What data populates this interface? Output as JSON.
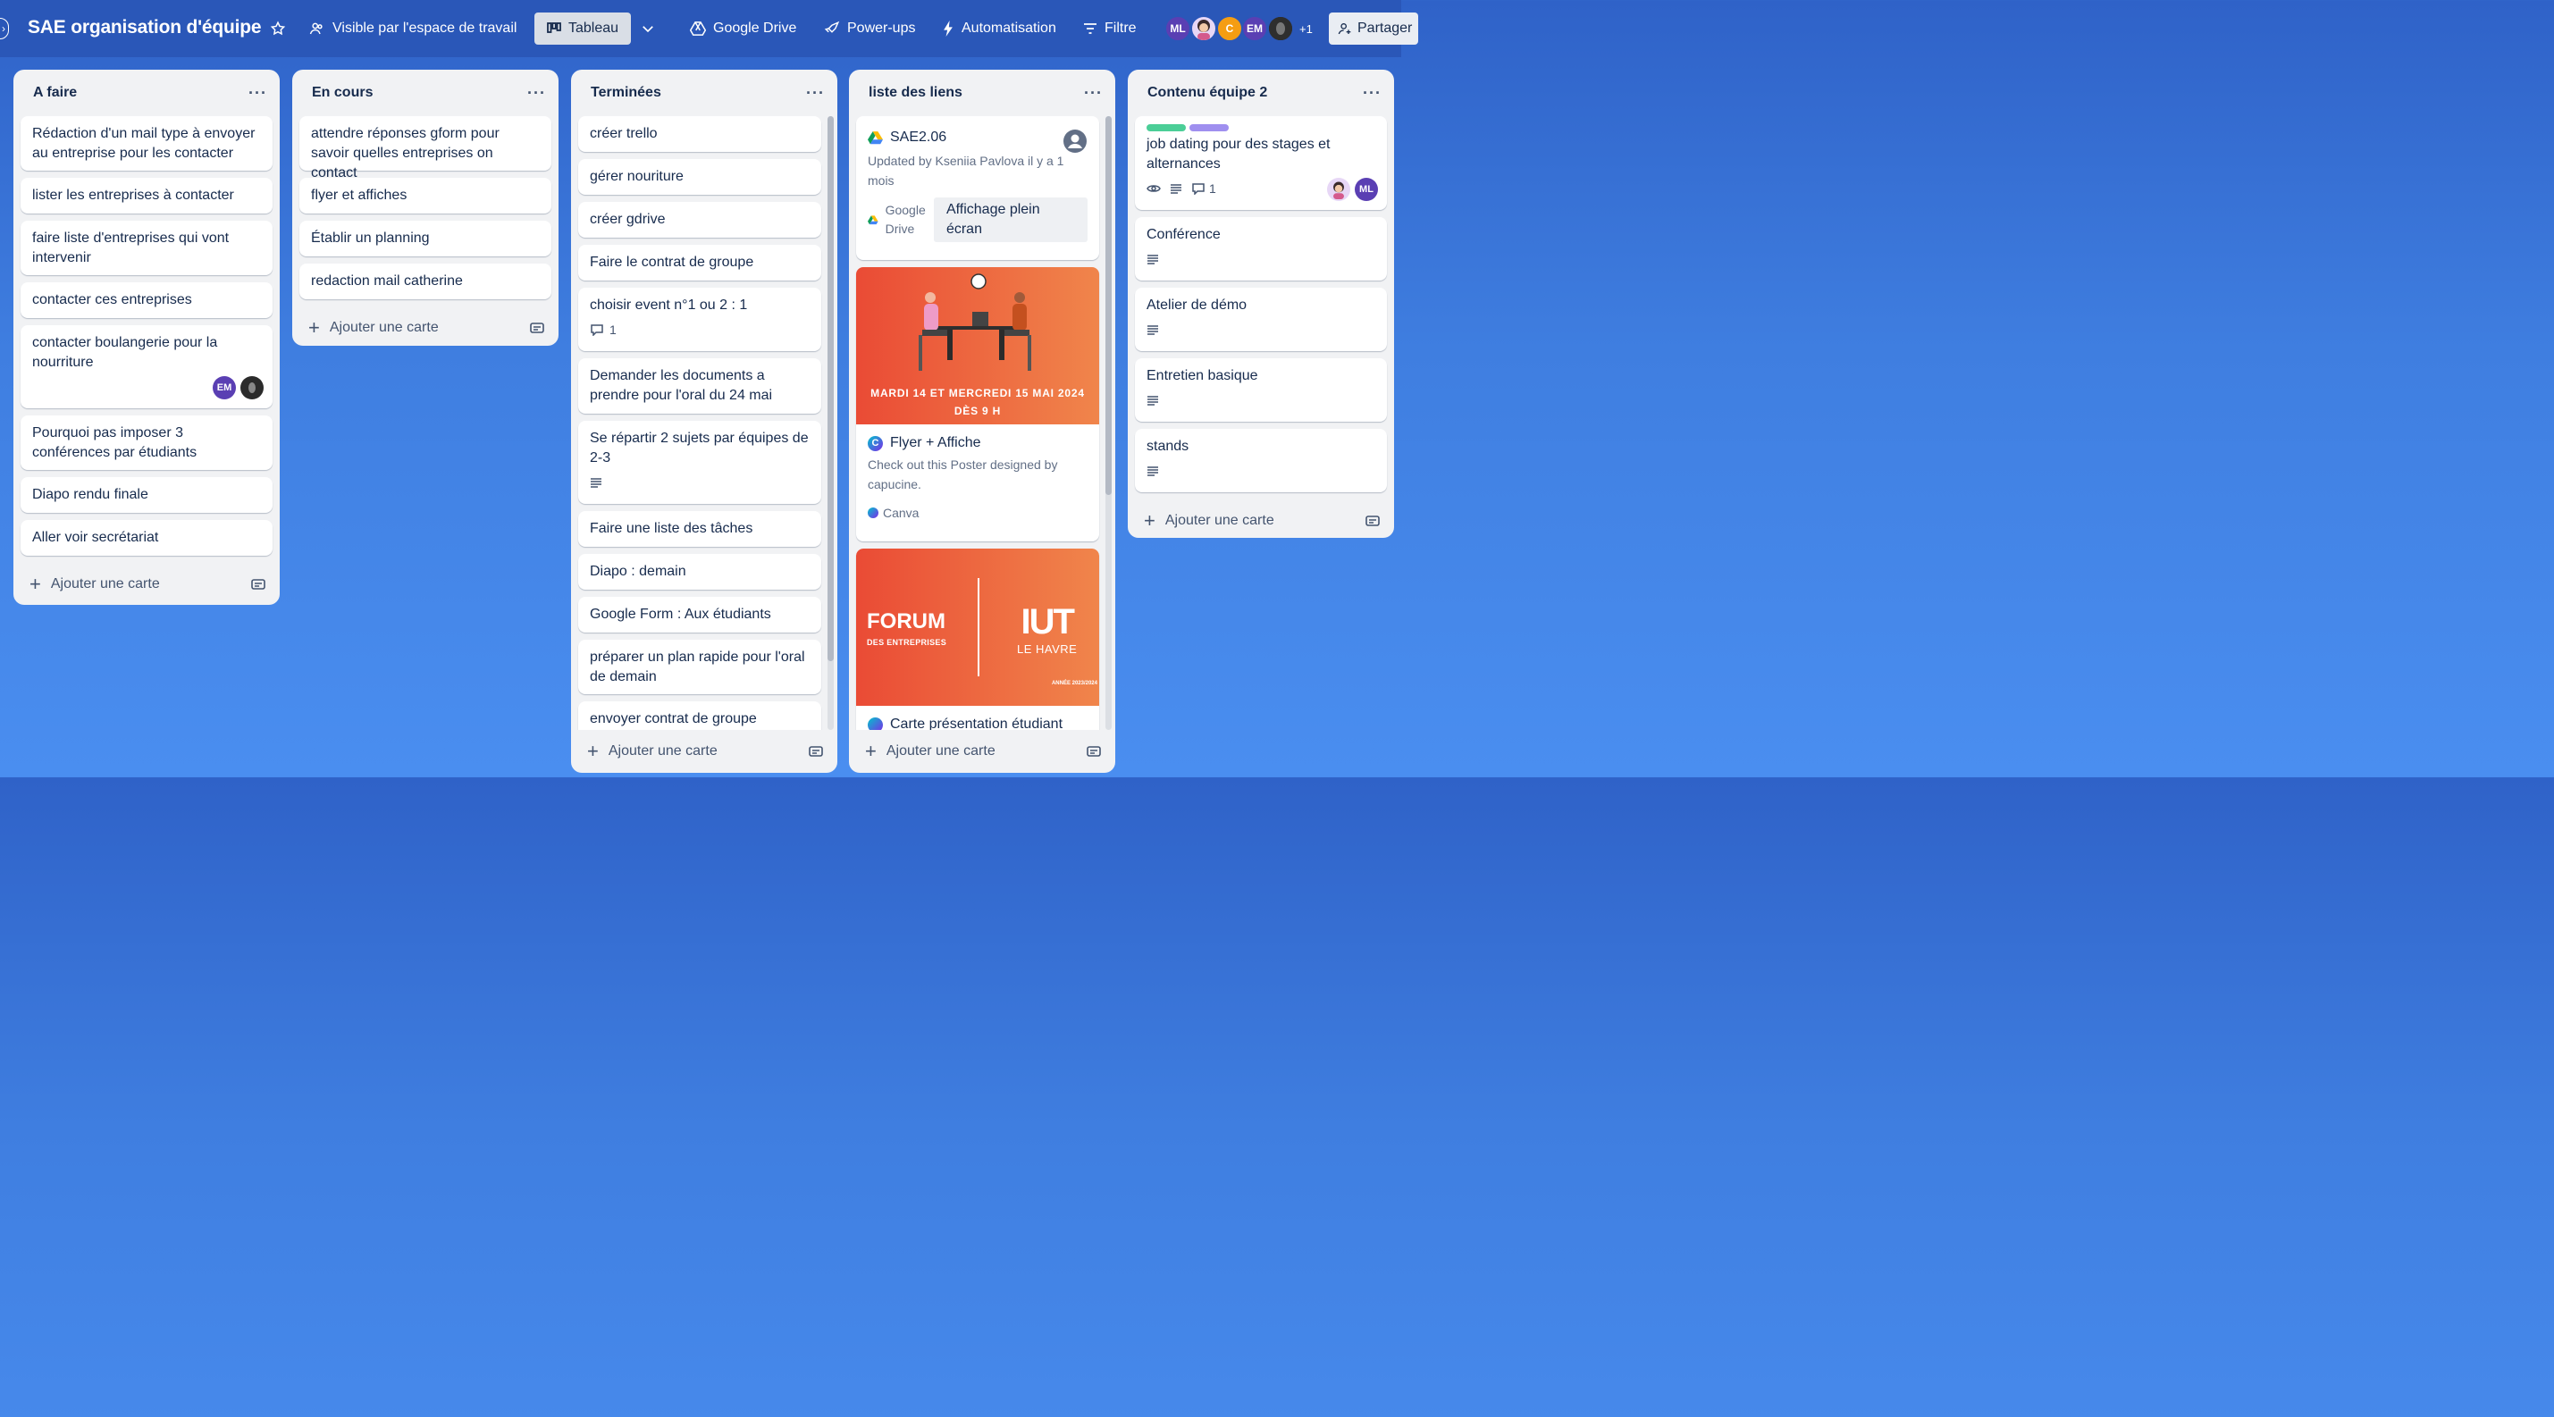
{
  "header": {
    "title": "SAE organisation d'équipe",
    "visibility": "Visible par l'espace de travail",
    "view_tab": "Tableau",
    "google_drive": "Google Drive",
    "powerups": "Power-ups",
    "automation": "Automatisation",
    "filter": "Filtre",
    "members": [
      "ML",
      "C",
      "EM"
    ],
    "more_members": "+1",
    "share": "Partager",
    "colors": {
      "header_bg": "#2a57b8",
      "ml": "#5a3fb3",
      "c": "#f59d12",
      "em": "#5a3fb3"
    }
  },
  "add_card_label": "Ajouter une carte",
  "lists": {
    "todo": {
      "title": "A faire",
      "cards": [
        "Rédaction d'un mail type à envoyer au entreprise pour les contacter",
        "lister les entreprises à contacter",
        "faire liste d'entreprises qui vont intervenir",
        "contacter ces entreprises",
        "contacter boulangerie pour la nourriture",
        "Pourquoi pas imposer 3 conférences par étudiants",
        "Diapo rendu finale",
        "Aller voir secrétariat"
      ],
      "card4_members": [
        "EM"
      ]
    },
    "doing": {
      "title": "En cours",
      "cards": [
        "attendre réponses gform pour savoir quelles entreprises on contact",
        "flyer et affiches",
        "Établir un planning",
        "redaction mail catherine"
      ]
    },
    "done": {
      "title": "Terminées",
      "cards": [
        "créer trello",
        "gérer nouriture",
        "créer gdrive",
        "Faire le contrat de groupe",
        "choisir event n°1 ou 2 : 1",
        "Demander les documents a prendre pour l'oral du 24 mai",
        "Se répartir 2 sujets par équipes de 2-3",
        "Faire une liste des tâches",
        "Diapo : demain",
        "Google Form : Aux étudiants",
        "préparer un plan rapide pour l'oral de demain",
        "envoyer contrat de groupe"
      ],
      "comment_count": "1"
    },
    "links": {
      "title": "liste des liens",
      "drive_card": {
        "title": "SAE2.06",
        "meta": "Updated by Kseniia Pavlova il y a 1 mois",
        "source": "Google Drive",
        "action": "Affichage plein écran"
      },
      "canva_card": {
        "cover_text_1": "MARDI 14 ET MERCREDI 15 MAI 2024",
        "cover_text_2": "DÈS 9 H",
        "title": "Flyer + Affiche",
        "meta": "Check out this Poster designed by capucine.",
        "source": "Canva"
      },
      "forum_card": {
        "forum": "FORUM",
        "forum_sub": "DES ENTREPRISES",
        "iut": "IUT",
        "iut_sub": "LE HAVRE",
        "year": "ANNÉE 2023/2024",
        "title": "Carte présentation étudiant"
      }
    },
    "team2": {
      "title": "Contenu équipe 2",
      "cards": [
        "job dating pour des stages et alternances",
        "Conférence",
        "Atelier de démo",
        "Entretien basique",
        "stands"
      ],
      "comment_count": "1",
      "members": [
        "ML"
      ],
      "label_colors": [
        "#4bce97",
        "#9f8fef"
      ]
    }
  }
}
